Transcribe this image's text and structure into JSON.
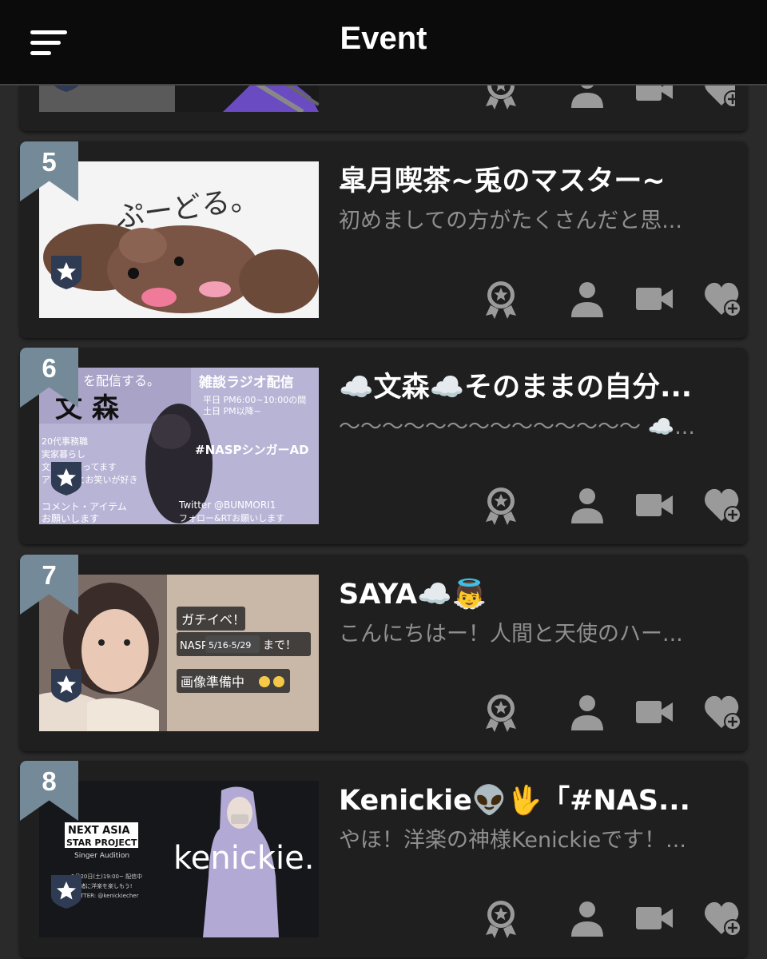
{
  "header": {
    "title": "Event"
  },
  "icons": {
    "menu": "menu-icon",
    "badge": "shield-star-icon",
    "actions": [
      "award-medal-icon",
      "person-icon",
      "video-camera-icon",
      "heart-plus-icon"
    ]
  },
  "colors": {
    "topbar": "#0b0b0b",
    "background": "#2a2a2a",
    "card": "#1f1f1f",
    "ribbon": "#748a99",
    "icon": "#9a9a9a",
    "shield": "#2f3b53"
  },
  "cards": [
    {
      "rank": "",
      "title": "",
      "description": ""
    },
    {
      "rank": "5",
      "title": "皐月喫茶~兎のマスター~",
      "description": "初めましての方がたくさんだと思...",
      "thumb_text": [
        "ぷーどる。"
      ]
    },
    {
      "rank": "6",
      "title": "☁️文森☁️そのままの自分...",
      "description": "〜〜〜〜〜〜〜〜〜〜〜〜〜〜 ☁️...",
      "thumb_text": [
        "を配信する。",
        "文 森",
        "雑談ラジオ配信",
        "平日 PM6:00~10:00の間",
        "土日 PM以降~",
        "#NASPシンガーAD",
        "20代事務職",
        "実家暮らし",
        "文鳥3羽飼ってます",
        "アイドルとお笑いが好き",
        "コメント・アイテム",
        "お願いします",
        "Twitter @BUNMORI1",
        "フォロー&RTお願いします"
      ]
    },
    {
      "rank": "7",
      "title": "SAYA☁️👼",
      "description": "こんにちはー！人間と天使のハー...",
      "thumb_text": [
        "ガチイベ！",
        "NASP",
        "5/16-5/29",
        "まで！",
        "画像準備中"
      ]
    },
    {
      "rank": "8",
      "title": "Kenickie👽🖖「#NAS...",
      "description": "やほ！洋楽の神様Kenickieです！...",
      "thumb_text": [
        "NEXT ASIA",
        "STAR PROJECT",
        "Singer Audition",
        "5月20日(土)19:00~ 配信中",
        "一緒に洋楽を楽しもう!",
        "TWITTER: @kenickiecher",
        "kenickie."
      ]
    }
  ]
}
